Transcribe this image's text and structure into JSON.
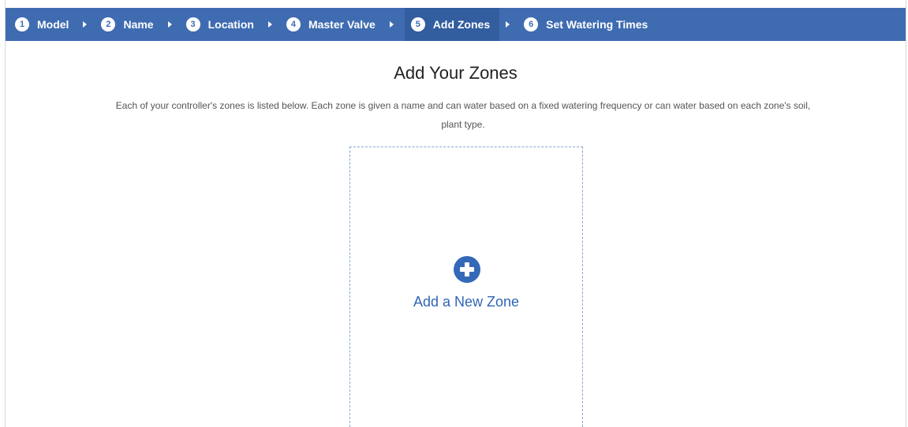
{
  "steps": [
    {
      "number": "1",
      "label": "Model"
    },
    {
      "number": "2",
      "label": "Name"
    },
    {
      "number": "3",
      "label": "Location"
    },
    {
      "number": "4",
      "label": "Master Valve"
    },
    {
      "number": "5",
      "label": "Add Zones"
    },
    {
      "number": "6",
      "label": "Set Watering Times"
    }
  ],
  "active_step": "5",
  "main": {
    "title": "Add Your Zones",
    "description": "Each of your controller's zones is listed below. Each zone is given a name and can water based on a fixed watering frequency or can water based on each zone's soil, plant type.",
    "add_zone_label": "Add a New Zone"
  },
  "colors": {
    "stepbar": "#3f6bb1",
    "active_step": "#325d9f",
    "accent": "#2f66b5"
  }
}
